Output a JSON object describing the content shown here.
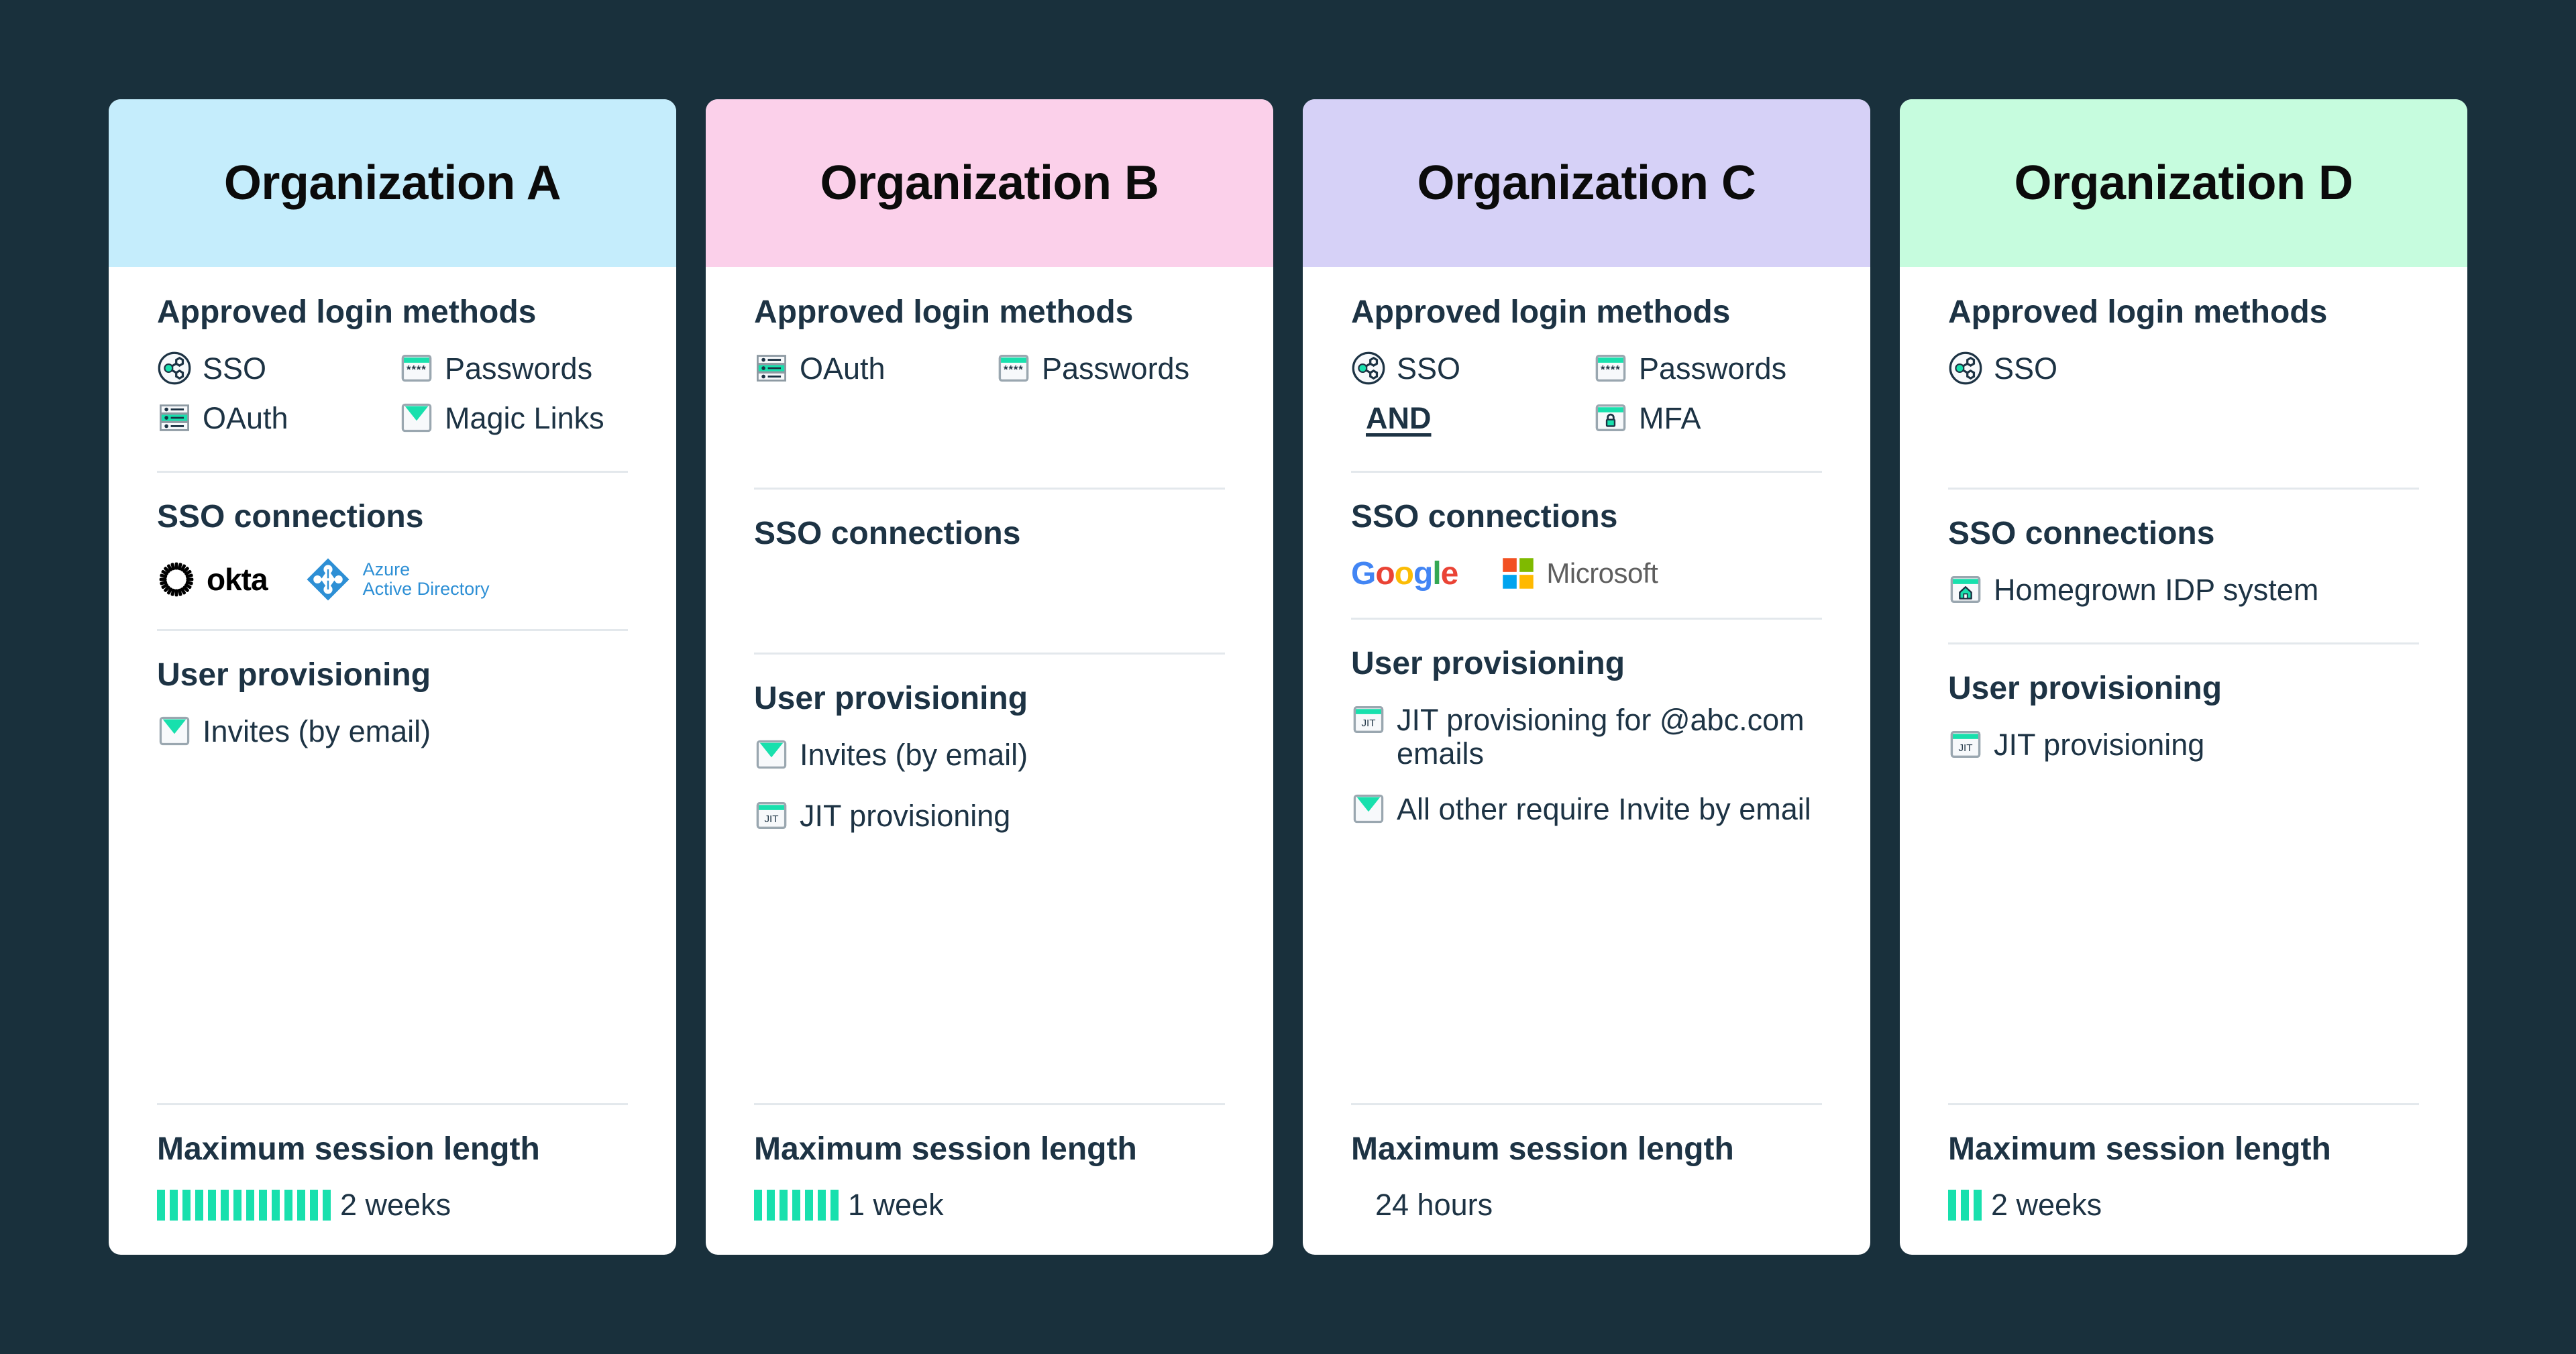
{
  "background_color": "#19303c",
  "accent_color": "#18e0ad",
  "text_color": "#1d3344",
  "section_labels": {
    "login_methods": "Approved login methods",
    "sso_connections": "SSO connections",
    "user_provisioning": "User provisioning",
    "max_session": "Maximum session length"
  },
  "cards": [
    {
      "title": "Organization A",
      "header_color": "#c5edfc",
      "login_methods": [
        {
          "icon": "sso-icon",
          "label": "SSO"
        },
        {
          "icon": "passwords-icon",
          "label": "Passwords"
        },
        {
          "icon": "oauth-icon",
          "label": "OAuth"
        },
        {
          "icon": "magic-links-icon",
          "label": "Magic Links"
        }
      ],
      "sso_connections": [
        {
          "icon": "okta-logo",
          "label": "okta"
        },
        {
          "icon": "azure-active-directory-logo",
          "label": "Azure Active Directory",
          "line1": "Azure",
          "line2": "Active Directory"
        }
      ],
      "user_provisioning": [
        {
          "icon": "magic-links-icon",
          "label": "Invites (by email)"
        }
      ],
      "session": {
        "bars": 14,
        "value": "2 weeks"
      }
    },
    {
      "title": "Organization B",
      "header_color": "#fbd0ea",
      "login_methods": [
        {
          "icon": "oauth-icon",
          "label": "OAuth"
        },
        {
          "icon": "passwords-icon",
          "label": "Passwords"
        }
      ],
      "sso_connections": [],
      "user_provisioning": [
        {
          "icon": "magic-links-icon",
          "label": "Invites (by email)"
        },
        {
          "icon": "jit-icon",
          "label": "JIT provisioning"
        }
      ],
      "session": {
        "bars": 7,
        "value": "1 week"
      }
    },
    {
      "title": "Organization C",
      "header_color": "#d6d1f7",
      "login_methods": [
        {
          "icon": "sso-icon",
          "label": "SSO"
        },
        {
          "icon": "passwords-icon",
          "label": "Passwords"
        },
        {
          "icon": "and-operator",
          "label": "AND"
        },
        {
          "icon": "mfa-icon",
          "label": "MFA"
        }
      ],
      "sso_connections": [
        {
          "icon": "google-logo",
          "label": "Google"
        },
        {
          "icon": "microsoft-logo",
          "label": "Microsoft"
        }
      ],
      "user_provisioning": [
        {
          "icon": "jit-icon",
          "label": "JIT provisioning for @abc.com emails"
        },
        {
          "icon": "magic-links-icon",
          "label": "All other require Invite by email"
        }
      ],
      "session": {
        "bars": 0,
        "value": "24 hours"
      }
    },
    {
      "title": "Organization D",
      "header_color": "#c6fcde",
      "login_methods": [
        {
          "icon": "sso-icon",
          "label": "SSO"
        }
      ],
      "sso_connections": [
        {
          "icon": "homegrown-idp-icon",
          "label": "Homegrown IDP system"
        }
      ],
      "user_provisioning": [
        {
          "icon": "jit-icon",
          "label": "JIT provisioning"
        }
      ],
      "session": {
        "bars": 3,
        "value": "2 weeks"
      }
    }
  ]
}
